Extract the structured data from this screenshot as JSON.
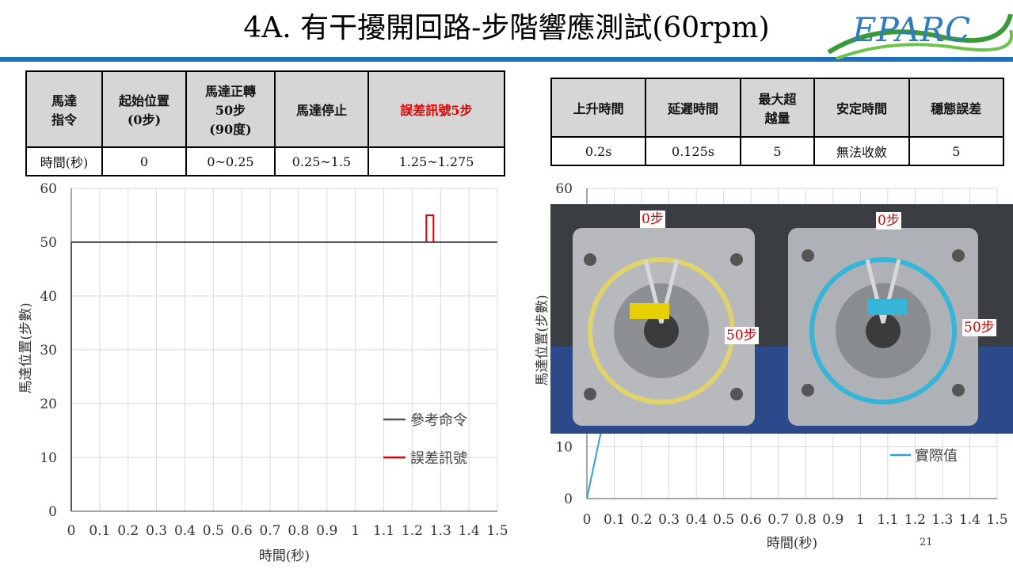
{
  "title": "4A. 有干擾開回路-步階響應測試(60rpm)",
  "logo_text": "EPARC",
  "page_number": "21",
  "table1": {
    "headers": [
      "馬達\n指令",
      "起始位置\n(0步)",
      "馬達正轉\n50步\n(90度)",
      "馬達停止",
      "誤差訊號5步"
    ],
    "row_label": "時間(秒)",
    "values": [
      "0",
      "0~0.25",
      "0.25~1.5",
      "1.25~1.275"
    ]
  },
  "table2": {
    "headers": [
      "上升時間",
      "延遲時間",
      "最大超\n越量",
      "安定時間",
      "穩態誤差"
    ],
    "values": [
      "0.2s",
      "0.125s",
      "5",
      "無法收斂",
      "5"
    ]
  },
  "colors": {
    "reference": "#555555",
    "error": "#e00000",
    "actual": "#2aa3d6",
    "title_bar": "#1f6fbf",
    "header_fill": "#d6d6d6"
  },
  "photo": {
    "labels": [
      "0步",
      "0步",
      "50步",
      "50步"
    ]
  },
  "chart_data": [
    {
      "type": "line",
      "xlabel": "時間(秒)",
      "ylabel": "馬達位置(步數)",
      "xlim": [
        0,
        1.5
      ],
      "ylim": [
        0,
        60
      ],
      "x_ticks": [
        "0",
        "0.1",
        "0.2",
        "0.3",
        "0.4",
        "0.5",
        "0.6",
        "0.7",
        "0.8",
        "0.9",
        "1",
        "1.1",
        "1.2",
        "1.3",
        "1.4",
        "1.5"
      ],
      "y_ticks": [
        "0",
        "10",
        "20",
        "30",
        "40",
        "50",
        "60"
      ],
      "grid": true,
      "legend_position": "bottom-right",
      "series": [
        {
          "name": "參考命令",
          "x": [
            0,
            0.0001,
            1.5
          ],
          "y": [
            0,
            50,
            50
          ]
        },
        {
          "name": "誤差訊號",
          "x": [
            1.25,
            1.25,
            1.275,
            1.275
          ],
          "y": [
            50,
            55,
            55,
            50
          ]
        }
      ]
    },
    {
      "type": "line",
      "xlabel": "時間(秒)",
      "ylabel": "馬達位置(步數)",
      "xlim": [
        0,
        1.5
      ],
      "ylim": [
        0,
        60
      ],
      "x_ticks": [
        "0",
        "0.1",
        "0.2",
        "0.3",
        "0.4",
        "0.5",
        "0.6",
        "0.7",
        "0.8",
        "0.9",
        "1",
        "1.1",
        "1.2",
        "1.3",
        "1.4",
        "1.5"
      ],
      "y_ticks": [
        "0",
        "10",
        "60"
      ],
      "grid": true,
      "legend_position": "bottom-right",
      "series": [
        {
          "name": "實際值",
          "x": [
            0,
            0.06
          ],
          "y": [
            0,
            15
          ]
        }
      ]
    }
  ]
}
